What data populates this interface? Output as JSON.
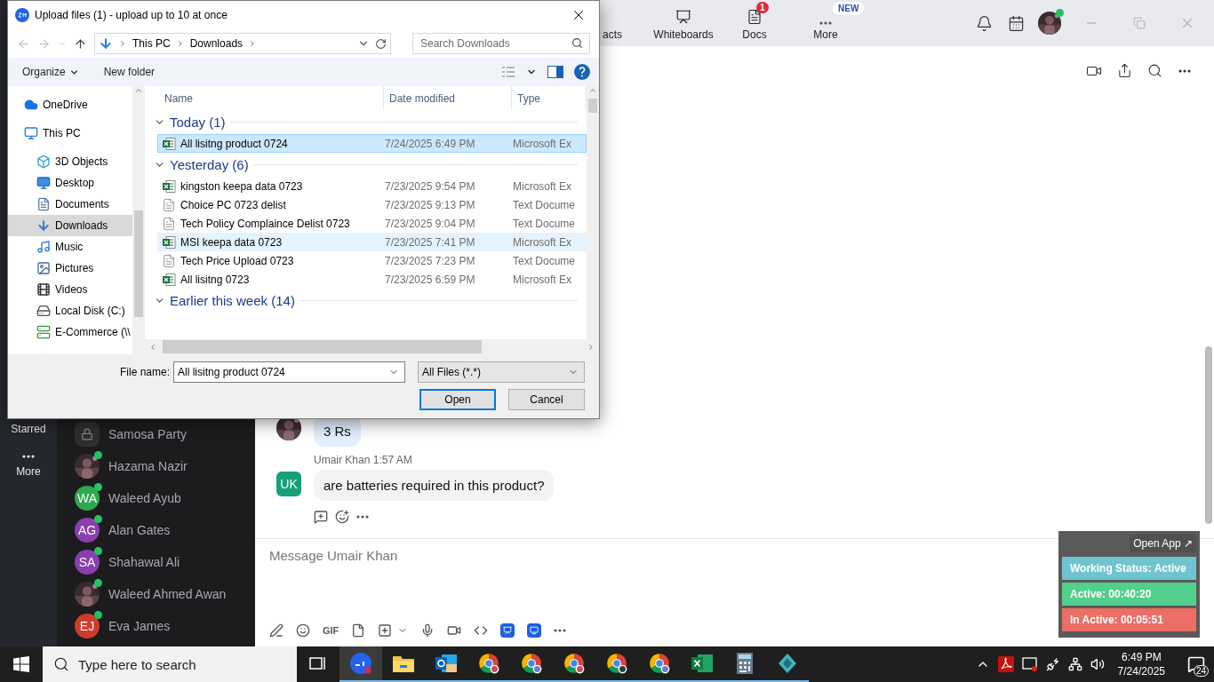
{
  "zoom": {
    "top_nav": [
      {
        "label": "acts"
      },
      {
        "label": "Whiteboards",
        "kind": "whiteboards"
      },
      {
        "label": "Docs",
        "kind": "docs",
        "badge": "1"
      },
      {
        "label": "More",
        "kind": "more",
        "badge": "NEW"
      }
    ],
    "rail": [
      {
        "label": "Starred"
      },
      {
        "label": "More",
        "kind": "more"
      }
    ],
    "chats": [
      {
        "name": "Samosa Party",
        "avatar": {
          "kind": "lock"
        },
        "online": false
      },
      {
        "name": "Hazama Nazir",
        "online": true
      },
      {
        "name": "Waleed Ayub",
        "avatar": {
          "kind": "initials",
          "initials": "WA",
          "color": "#2ea84e"
        },
        "online": true
      },
      {
        "name": "Alan Gates",
        "avatar": {
          "kind": "initials",
          "initials": "AG",
          "color": "#8a3fb0"
        },
        "online": true
      },
      {
        "name": "Shahawal Ali",
        "avatar": {
          "kind": "initials",
          "initials": "SA",
          "color": "#8a3fb0"
        },
        "online": true
      },
      {
        "name": "Waleed Ahmed Awan",
        "online": true
      },
      {
        "name": "Eva James",
        "avatar": {
          "kind": "initials",
          "initials": "EJ",
          "color": "#cf3b2b"
        },
        "online": true
      }
    ],
    "messages": [
      {
        "text": "3 Rs"
      },
      {
        "sender": "Umair Khan",
        "time": "1:57 AM",
        "text": "are batteries required in this product?",
        "avatar": {
          "kind": "initials",
          "initials": "UK",
          "color": "#16a07a"
        }
      }
    ],
    "compose": {
      "placeholder": "Message Umair Khan",
      "gif": "GIF"
    },
    "tracker": {
      "open_app": "Open App ↗",
      "statuses": [
        {
          "label": "Working Status: Active",
          "color": "#6ec5d0"
        },
        {
          "label": "Active: 00:40:20",
          "color": "#52cf8a"
        },
        {
          "label": "In Active: 00:05:51",
          "color": "#ec6e64"
        }
      ]
    }
  },
  "dialog": {
    "title": "Upload files (1) - upload up to 10 at once",
    "address": [
      "This PC",
      "Downloads"
    ],
    "search": {
      "placeholder": "Search Downloads"
    },
    "toolbar": [
      "Organize",
      "New folder"
    ],
    "nav": [
      {
        "label": "OneDrive",
        "kind": "cloud",
        "selected": false
      },
      {
        "label": "This PC",
        "kind": "pc",
        "selected": false,
        "children": [
          {
            "label": "3D Objects",
            "kind": "cube",
            "selected": false
          },
          {
            "label": "Desktop",
            "kind": "desktop",
            "selected": false
          },
          {
            "label": "Documents",
            "kind": "documents",
            "selected": false
          },
          {
            "label": "Downloads",
            "kind": "downloads",
            "selected": true
          },
          {
            "label": "Music",
            "kind": "music",
            "selected": false
          },
          {
            "label": "Pictures",
            "kind": "pictures",
            "selected": false
          },
          {
            "label": "Videos",
            "kind": "videos",
            "selected": false
          },
          {
            "label": "Local Disk (C:)",
            "kind": "disk",
            "selected": false
          },
          {
            "label": "E-Commerce (\\\\",
            "kind": "netdrive",
            "selected": false
          }
        ]
      }
    ],
    "columns": [
      "Name",
      "Date modified",
      "Type"
    ],
    "groups": [
      {
        "label": "Today (1)",
        "expanded": true,
        "files": [
          {
            "name": "All lisitng product 0724",
            "date": "7/24/2025 6:49 PM",
            "type": "Microsoft Ex",
            "kind": "excel",
            "selected": true,
            "hovered": false
          }
        ]
      },
      {
        "label": "Yesterday (6)",
        "expanded": true,
        "files": [
          {
            "name": "kingston keepa data 0723",
            "date": "7/23/2025 9:54 PM",
            "type": "Microsoft Ex",
            "kind": "excel",
            "selected": false,
            "hovered": false
          },
          {
            "name": "Choice PC 0723 delist",
            "date": "7/23/2025 9:13 PM",
            "type": "Text Docume",
            "kind": "text",
            "selected": false,
            "hovered": false
          },
          {
            "name": "Tech Policy Complaince Delist 0723",
            "date": "7/23/2025 9:04 PM",
            "type": "Text Docume",
            "kind": "text",
            "selected": false,
            "hovered": false
          },
          {
            "name": "MSI keepa data 0723",
            "date": "7/23/2025 7:41 PM",
            "type": "Microsoft Ex",
            "kind": "excel",
            "selected": false,
            "hovered": true
          },
          {
            "name": "Tech Price Upload 0723",
            "date": "7/23/2025 7:23 PM",
            "type": "Text Docume",
            "kind": "text",
            "selected": false,
            "hovered": false
          },
          {
            "name": "All lisitng 0723",
            "date": "7/23/2025 6:59 PM",
            "type": "Microsoft Ex",
            "kind": "excel",
            "selected": false,
            "hovered": false
          }
        ]
      },
      {
        "label": "Earlier this week (14)",
        "expanded": true
      }
    ],
    "file_name": {
      "label": "File name:",
      "value": "All lisitng product 0724"
    },
    "filter": "All Files (*.*)",
    "buttons": [
      "Open",
      "Cancel"
    ]
  },
  "taskbar": {
    "search": {
      "placeholder": "Type here to search"
    },
    "apps": [
      {
        "kind": "taskview",
        "selected": false
      },
      {
        "kind": "zoom",
        "selected": true
      },
      {
        "kind": "explorer",
        "selected": false
      },
      {
        "kind": "outlook",
        "selected": false
      },
      {
        "kind": "chrome",
        "selected": false
      },
      {
        "kind": "chrome",
        "selected": false
      },
      {
        "kind": "chrome",
        "selected": false
      },
      {
        "kind": "chrome",
        "selected": false
      },
      {
        "kind": "chrome",
        "selected": false
      },
      {
        "kind": "excel",
        "selected": false
      },
      {
        "kind": "calculator",
        "selected": false
      },
      {
        "kind": "app",
        "selected": false
      }
    ],
    "time": "6:49 PM",
    "date": "7/24/2025",
    "notifications": "24"
  }
}
